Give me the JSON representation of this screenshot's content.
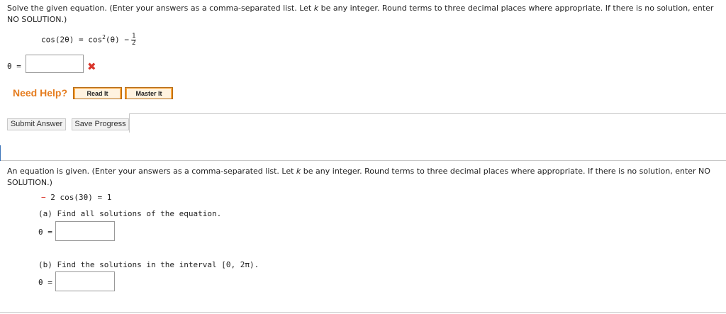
{
  "q1": {
    "prompt_part1": "Solve the given equation. (Enter your answers as a comma-separated list. Let ",
    "var_k": "k",
    "prompt_part2": " be any integer. Round terms to three decimal places where appropriate. If there is no solution, enter NO SOLUTION.)",
    "eq_lhs": "cos(2θ) = cos",
    "eq_exp": "2",
    "eq_rhs": "(θ) −",
    "eq_frac_num": "1",
    "eq_frac_den": "2",
    "answer_label": "θ =",
    "answer_value": "",
    "status_mark": "✖"
  },
  "help": {
    "label": "Need Help?",
    "read_it": "Read It",
    "master_it": "Master It"
  },
  "actions": {
    "submit": "Submit Answer",
    "save": "Save Progress"
  },
  "q2": {
    "prompt_part1": "An equation is given. (Enter your answers as a comma-separated list. Let ",
    "var_k": "k",
    "prompt_part2": " be any integer. Round terms to three decimal places where appropriate. If there is no solution, enter NO SOLUTION.)",
    "equation": "− 2 cos(3θ) = 1",
    "part_a": "(a) Find all solutions of the equation.",
    "part_b": "(b) Find the solutions in the interval [0, 2π).",
    "answer_label": "θ =",
    "answer_a_value": "",
    "answer_b_value": ""
  },
  "colors": {
    "wrong": "#d9352b",
    "help_label": "#e57c1e",
    "help_button": "#f7a33b",
    "equation_minus": "#d9352b"
  }
}
